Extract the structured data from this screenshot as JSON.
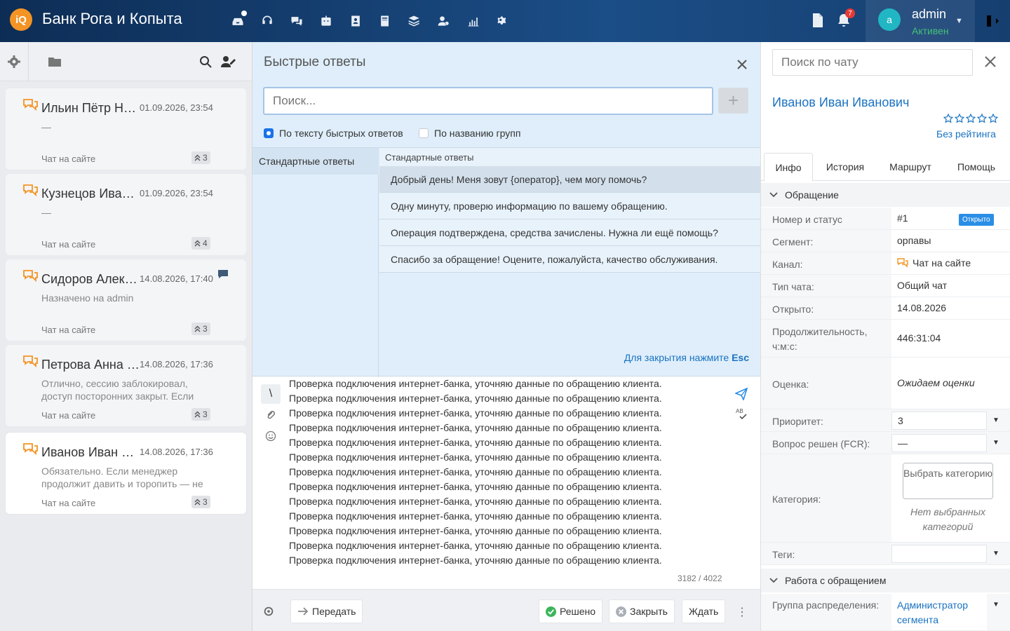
{
  "header": {
    "logo_text": "iQ",
    "brand": "Банк Рога и Копыта",
    "nav_icons": [
      "inbox-icon",
      "headset-icon",
      "chats-icon",
      "robot-icon",
      "contacts-icon",
      "knowledge-book-icon",
      "layers-icon",
      "users-settings-icon",
      "analytics-icon",
      "settings-gears-icon"
    ],
    "notifications_count": "7",
    "user": {
      "avatar_letter": "a",
      "name": "admin",
      "status": "Активен"
    }
  },
  "chat_list": [
    {
      "name": "Ильин Пётр Никола",
      "date": "01.09.2026, 23:54",
      "message": "—",
      "channel": "Чат на сайте",
      "count": "3",
      "active": false
    },
    {
      "name": "Кузнецов Иван Петрович",
      "date": "01.09.2026, 23:54",
      "message": "—",
      "channel": "Чат на сайте",
      "count": "4",
      "active": false
    },
    {
      "name": "Сидоров Алексей",
      "date": "14.08.2026, 17:40",
      "message": "Назначено на admin",
      "channel": "Чат на сайте",
      "count": "3",
      "active": false
    },
    {
      "name": "Петрова Анна Сергеевна",
      "date": "14.08.2026, 17:36",
      "message": "Отлично, сессию заблокировал, доступ посторонних закрыт. Если",
      "channel": "Чат на сайте",
      "count": "3",
      "active": false
    },
    {
      "name": "Иванов Иван Иванович",
      "date": "14.08.2026, 17:36",
      "message": "Обязательно. Если менеджер продолжит давить и торопить — не ведитесь",
      "channel": "Чат на сайте",
      "count": "3",
      "active": true
    }
  ],
  "quick_answers": {
    "title": "Быстрые ответы",
    "search_placeholder": "Поиск...",
    "add_label": "+",
    "option_text": "По тексту быстрых ответов",
    "option_groups": "По названию групп",
    "group": "Стандартные ответы",
    "list_header": "Стандартные ответы",
    "items": [
      "Добрый день! Меня зовут {оператор}, чем могу помочь?",
      "Одну минуту, проверю информацию по вашему обращению.",
      "Операция подтверждена, средства зачислены. Нужна ли ещё помощь?",
      "Спасибо за обращение! Оцените, пожалуйста, качество обслуживания."
    ],
    "hint_text": "Для закрытия нажмите ",
    "hint_key": "Esc"
  },
  "editor": {
    "slash": "\\",
    "line": "Проверка подключения интернет-банка, уточняю данные по обращению клиента.",
    "counter": "3182 / 4022"
  },
  "bottom_bar": {
    "transfer": "Передать",
    "resolved": "Решено",
    "close": "Закрыть",
    "wait": "Ждать"
  },
  "right_panel": {
    "search_placeholder": "Поиск по чату",
    "client_name": "Иванов Иван Иванович",
    "rating_text": "Без рейтинга",
    "tabs": [
      "Инфо",
      "История",
      "Маршрут",
      "Помощь"
    ],
    "section_request": "Обращение",
    "number_label": "Номер и статус",
    "number_value": "#1",
    "status_value": "Открыто",
    "segment_label": "Сегмент:",
    "segment_value": "орпавы",
    "channel_label": "Канал:",
    "channel_value": "Чат на сайте",
    "chat_type_label": "Тип чата:",
    "chat_type_value": "Общий чат",
    "opened_label": "Открыто:",
    "opened_value": "14.08.2026",
    "duration_label": "Продолжительность, ч:м:с:",
    "duration_value": "446:31:04",
    "score_label": "Оценка:",
    "score_value": "Ожидаем оценки",
    "priority_label": "Приоритет:",
    "priority_value": "3",
    "fcr_label": "Вопрос решен (FCR):",
    "fcr_value": "—",
    "category_label": "Категория:",
    "category_button": "Выбрать категорию",
    "category_none": "Нет выбранных категорий",
    "tags_label": "Теги:",
    "tags_value": "",
    "section_work": "Работа с обращением",
    "group_label": "Группа распределения:",
    "group_value": "Администратор сегмента"
  },
  "colors": {
    "topbar": "#123a68",
    "accent": "#1a73c2",
    "orange": "#f39424",
    "status_green": "#45c07a",
    "badge_red": "#e53935"
  }
}
